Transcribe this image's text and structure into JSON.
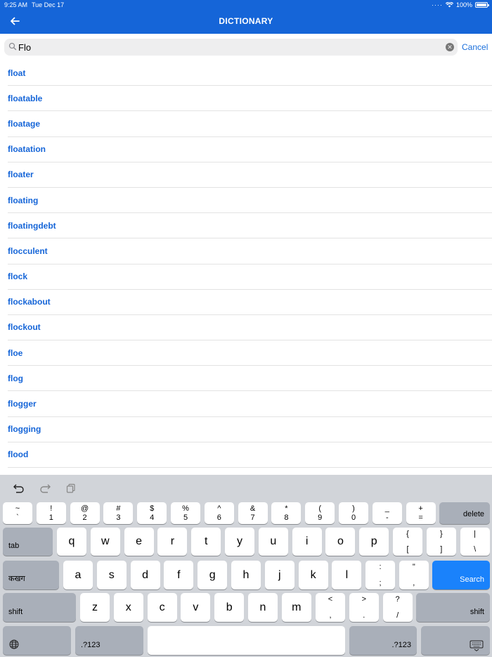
{
  "status": {
    "time": "9:25 AM",
    "date": "Tue Dec 17",
    "battery": "100%"
  },
  "header": {
    "title": "DICTIONARY"
  },
  "search": {
    "value": "Flo",
    "placeholder": "",
    "cancel_label": "Cancel"
  },
  "results": [
    "float",
    "floatable",
    "floatage",
    "floatation",
    "floater",
    "floating",
    "floatingdebt",
    "flocculent",
    "flock",
    "flockabout",
    "flockout",
    "floe",
    "flog",
    "flogger",
    "flogging",
    "flood"
  ],
  "keyboard": {
    "row1": [
      {
        "top": "~",
        "bottom": "`"
      },
      {
        "top": "!",
        "bottom": "1"
      },
      {
        "top": "@",
        "bottom": "2"
      },
      {
        "top": "#",
        "bottom": "3"
      },
      {
        "top": "$",
        "bottom": "4"
      },
      {
        "top": "%",
        "bottom": "5"
      },
      {
        "top": "^",
        "bottom": "6"
      },
      {
        "top": "&",
        "bottom": "7"
      },
      {
        "top": "*",
        "bottom": "8"
      },
      {
        "top": "(",
        "bottom": "9"
      },
      {
        "top": ")",
        "bottom": "0"
      },
      {
        "top": "_",
        "bottom": "-"
      },
      {
        "top": "+",
        "bottom": "="
      }
    ],
    "delete_label": "delete",
    "tab_label": "tab",
    "row2": [
      "q",
      "w",
      "e",
      "r",
      "t",
      "y",
      "u",
      "i",
      "o",
      "p"
    ],
    "row2_extra": [
      {
        "top": "{",
        "bottom": "["
      },
      {
        "top": "}",
        "bottom": "]"
      },
      {
        "top": "|",
        "bottom": "\\"
      }
    ],
    "lang_label": "कखग",
    "row3": [
      "a",
      "s",
      "d",
      "f",
      "g",
      "h",
      "j",
      "k",
      "l"
    ],
    "row3_extra": [
      {
        "top": ":",
        "bottom": ";"
      },
      {
        "top": "\"",
        "bottom": ","
      }
    ],
    "search_label": "Search",
    "shift_label": "shift",
    "row4": [
      "z",
      "x",
      "c",
      "v",
      "b",
      "n",
      "m"
    ],
    "row4_extra": [
      {
        "top": "<",
        "bottom": ","
      },
      {
        "top": ">",
        "bottom": "."
      },
      {
        "top": "?",
        "bottom": "/"
      }
    ],
    "numbers_label": ".?123"
  },
  "colors": {
    "header": "#1565d8",
    "link": "#1565d8",
    "accent": "#1a82fb"
  }
}
